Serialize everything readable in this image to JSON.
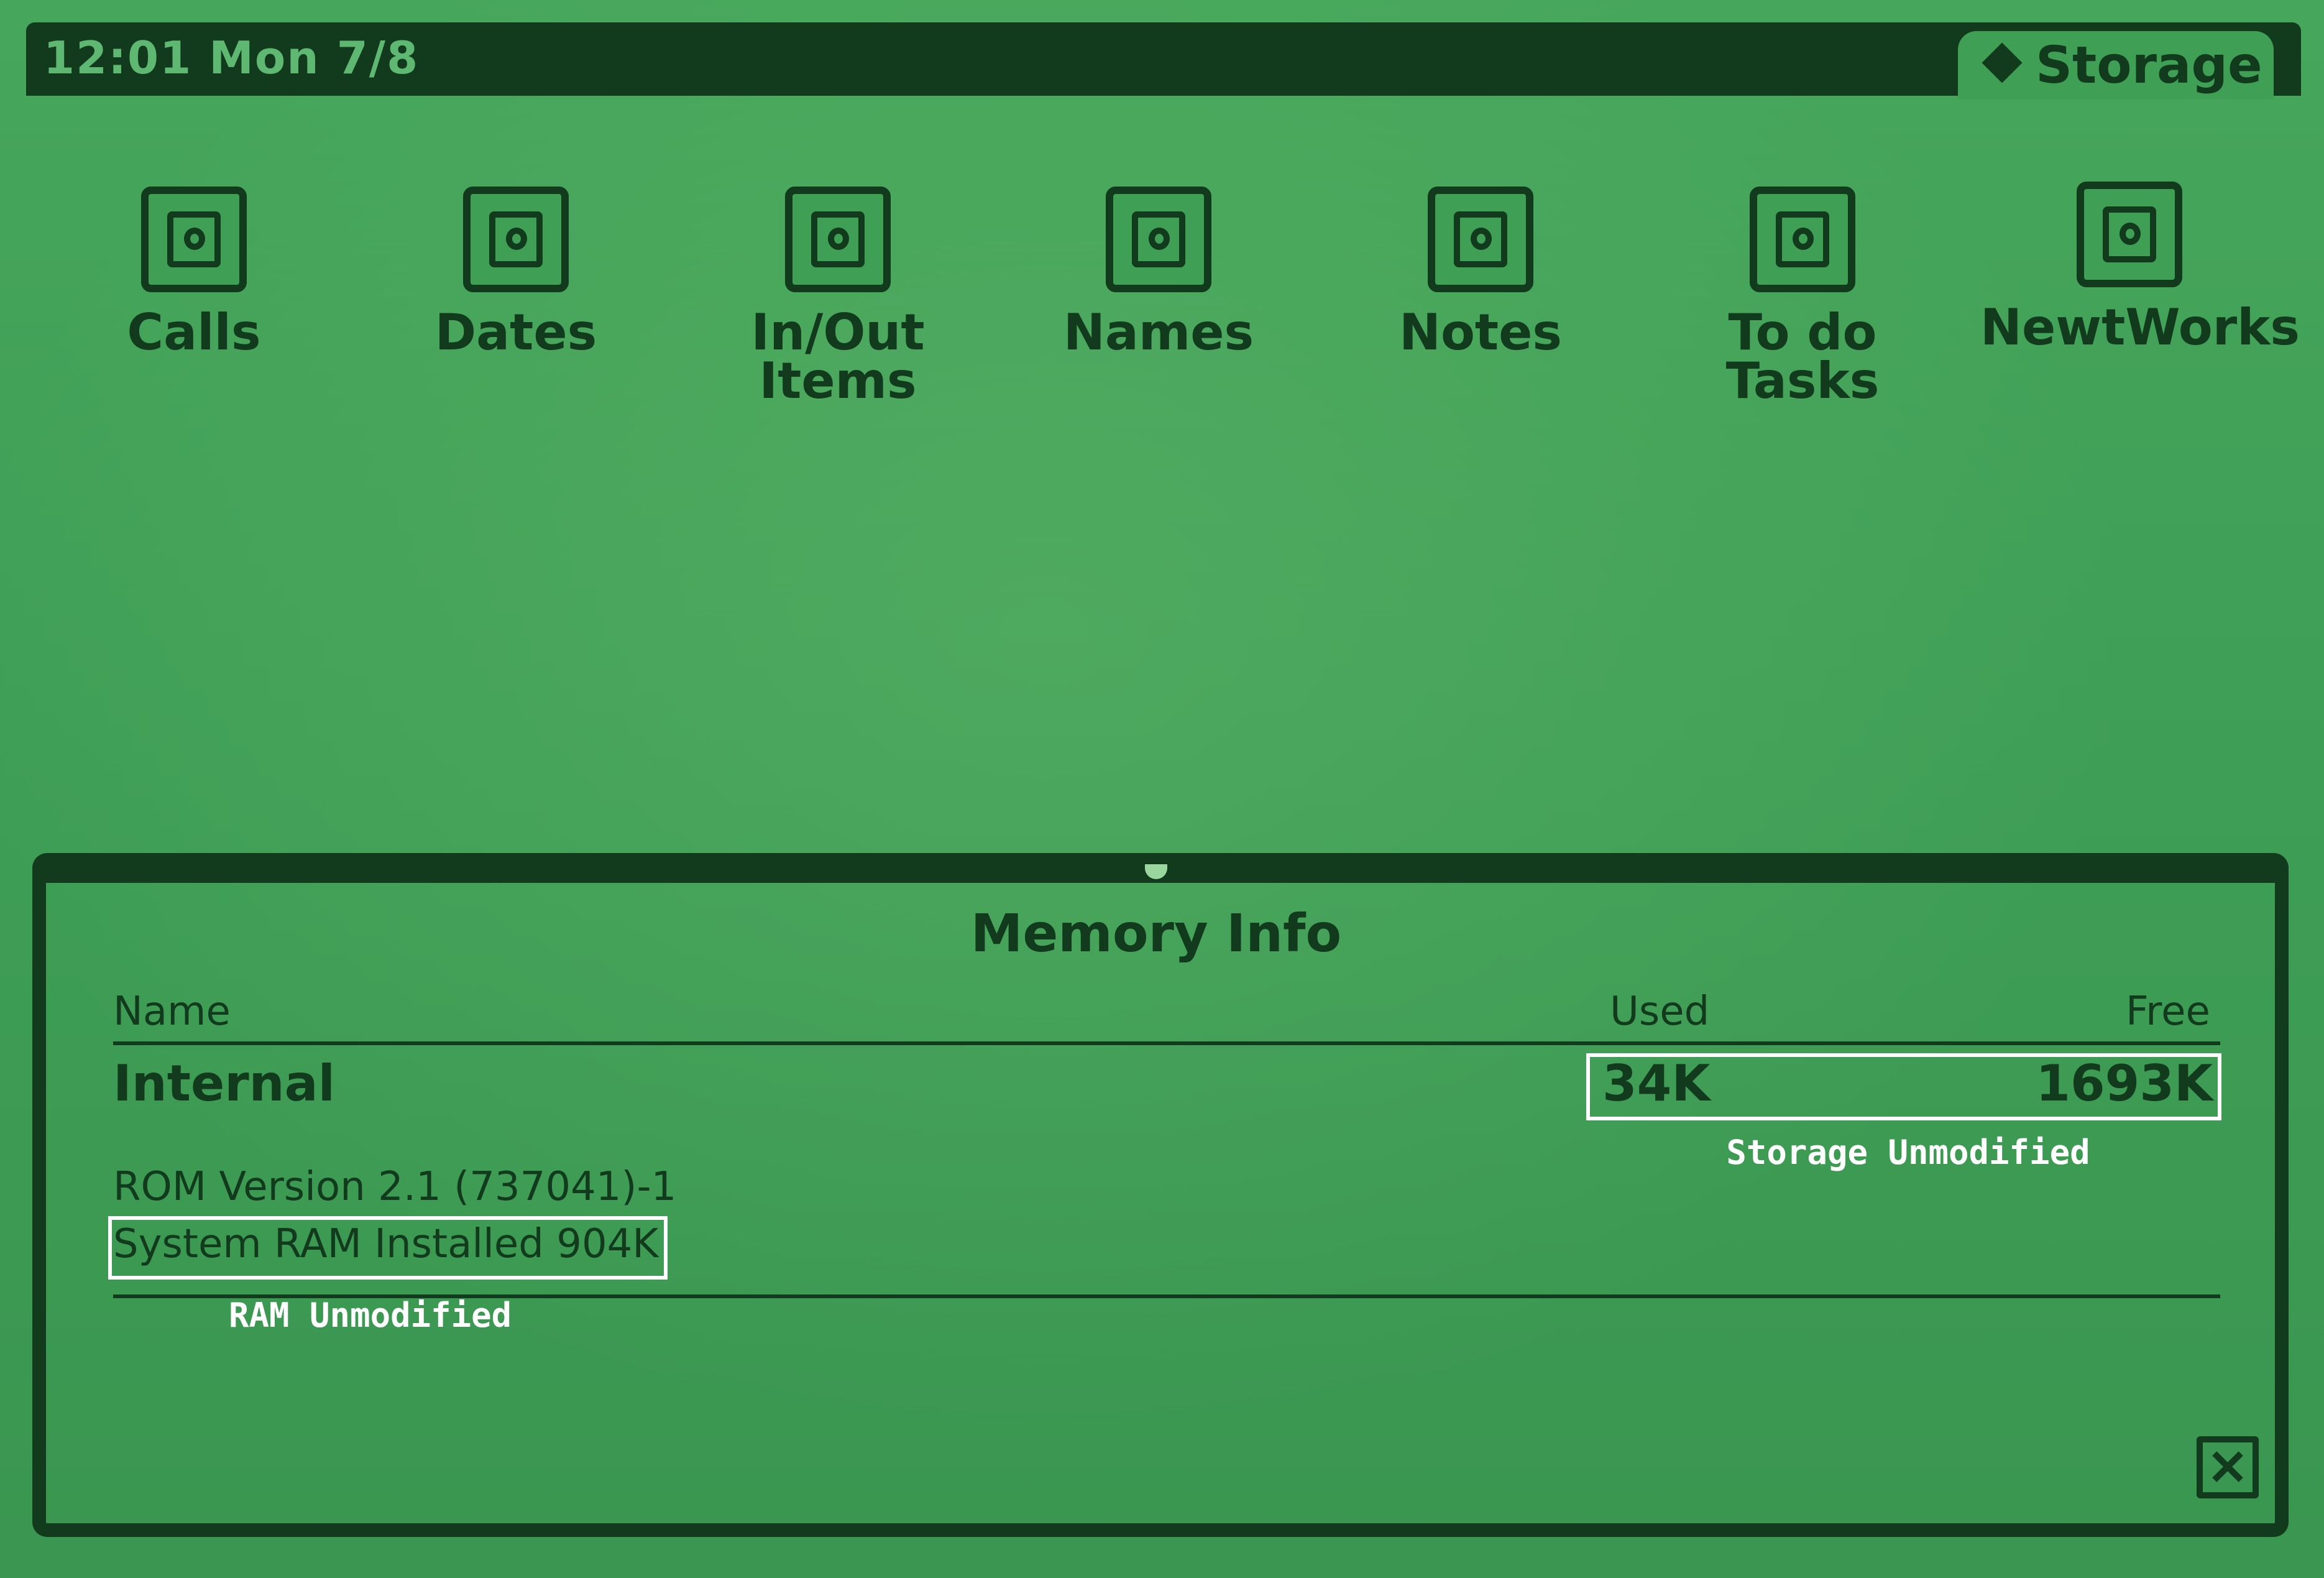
{
  "status_bar": {
    "clock": "12:01 Mon 7/8",
    "folder_tab": "Storage"
  },
  "apps": [
    {
      "label": "Calls",
      "icon": "card-icon"
    },
    {
      "label": "Dates",
      "icon": "card-icon"
    },
    {
      "label": "In/Out\nItems",
      "icon": "card-icon"
    },
    {
      "label": "Names",
      "icon": "card-icon"
    },
    {
      "label": "Notes",
      "icon": "card-icon"
    },
    {
      "label": "To do\nTasks",
      "icon": "card-icon"
    },
    {
      "label": "NewtWorks",
      "icon": "card-icon"
    }
  ],
  "memory_info": {
    "title": "Memory Info",
    "columns": {
      "name": "Name",
      "used": "Used",
      "free": "Free"
    },
    "row": {
      "name": "Internal",
      "used": "34K",
      "free": "1693K"
    },
    "rom_version": "ROM Version 2.1 (737041)-1",
    "system_ram": "System RAM Installed 904K"
  },
  "annotations": {
    "storage_note": "Storage Unmodified",
    "ram_note": "RAM Unmodified"
  },
  "colors": {
    "screen": "#3fa055",
    "ink": "#123a1c",
    "annotation": "#ffffff"
  }
}
